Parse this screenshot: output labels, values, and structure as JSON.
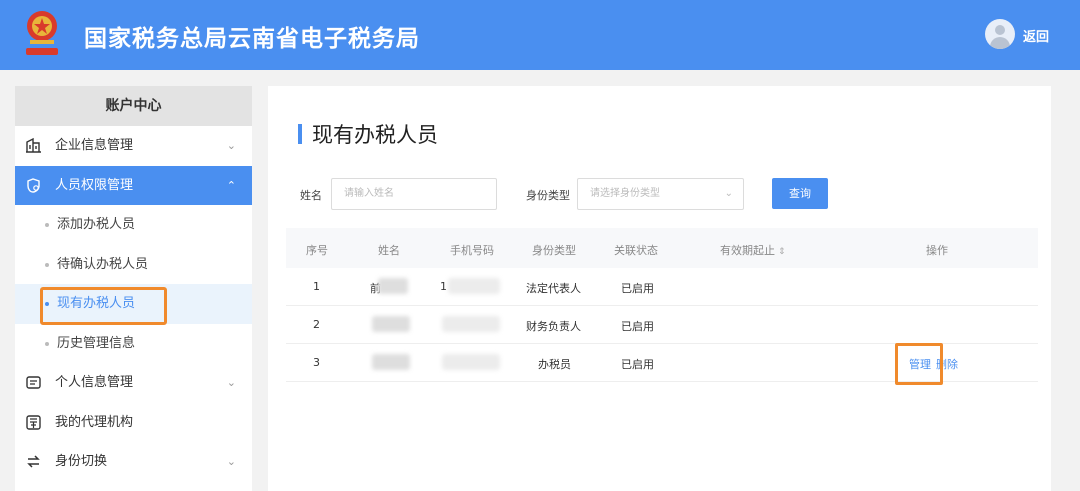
{
  "header": {
    "title": "国家税务总局云南省电子税务局",
    "back_label": "返回",
    "emblem_icon": "tax-emblem-icon",
    "brand_color": "#4a8ff0"
  },
  "sidebar": {
    "heading": "账户中心",
    "items": [
      {
        "label": "企业信息管理",
        "icon": "building-icon",
        "chevron": "down"
      },
      {
        "label": "人员权限管理",
        "icon": "user-shield-icon",
        "chevron": "up",
        "active": true
      },
      {
        "label": "个人信息管理",
        "icon": "id-card-icon",
        "chevron": "down"
      },
      {
        "label": "我的代理机构",
        "icon": "agency-icon"
      },
      {
        "label": "身份切换",
        "icon": "switch-icon",
        "chevron": "down"
      }
    ],
    "sub_items": [
      {
        "label": "添加办税人员"
      },
      {
        "label": "待确认办税人员"
      },
      {
        "label": "现有办税人员",
        "current": true
      },
      {
        "label": "历史管理信息"
      }
    ]
  },
  "main": {
    "title": "现有办税人员",
    "filters": {
      "name_label": "姓名",
      "name_placeholder": "请输入姓名",
      "type_label": "身份类型",
      "type_placeholder": "请选择身份类型",
      "query_label": "查询"
    },
    "table": {
      "columns": [
        "序号",
        "姓名",
        "手机号码",
        "身份类型",
        "关联状态",
        "有效期起止",
        "操作"
      ],
      "rows": [
        {
          "index": "1",
          "name": "前",
          "phone": "1",
          "type": "法定代表人",
          "status": "已启用"
        },
        {
          "index": "2",
          "name": "",
          "phone": "",
          "type": "财务负责人",
          "status": "已启用"
        },
        {
          "index": "3",
          "name": "",
          "phone": "",
          "type": "办税员",
          "status": "已启用",
          "actions": [
            "管理",
            "删除"
          ]
        }
      ]
    }
  },
  "accent_colors": {
    "highlight": "#f08a2c",
    "active_bg": "#4a8ff0"
  }
}
